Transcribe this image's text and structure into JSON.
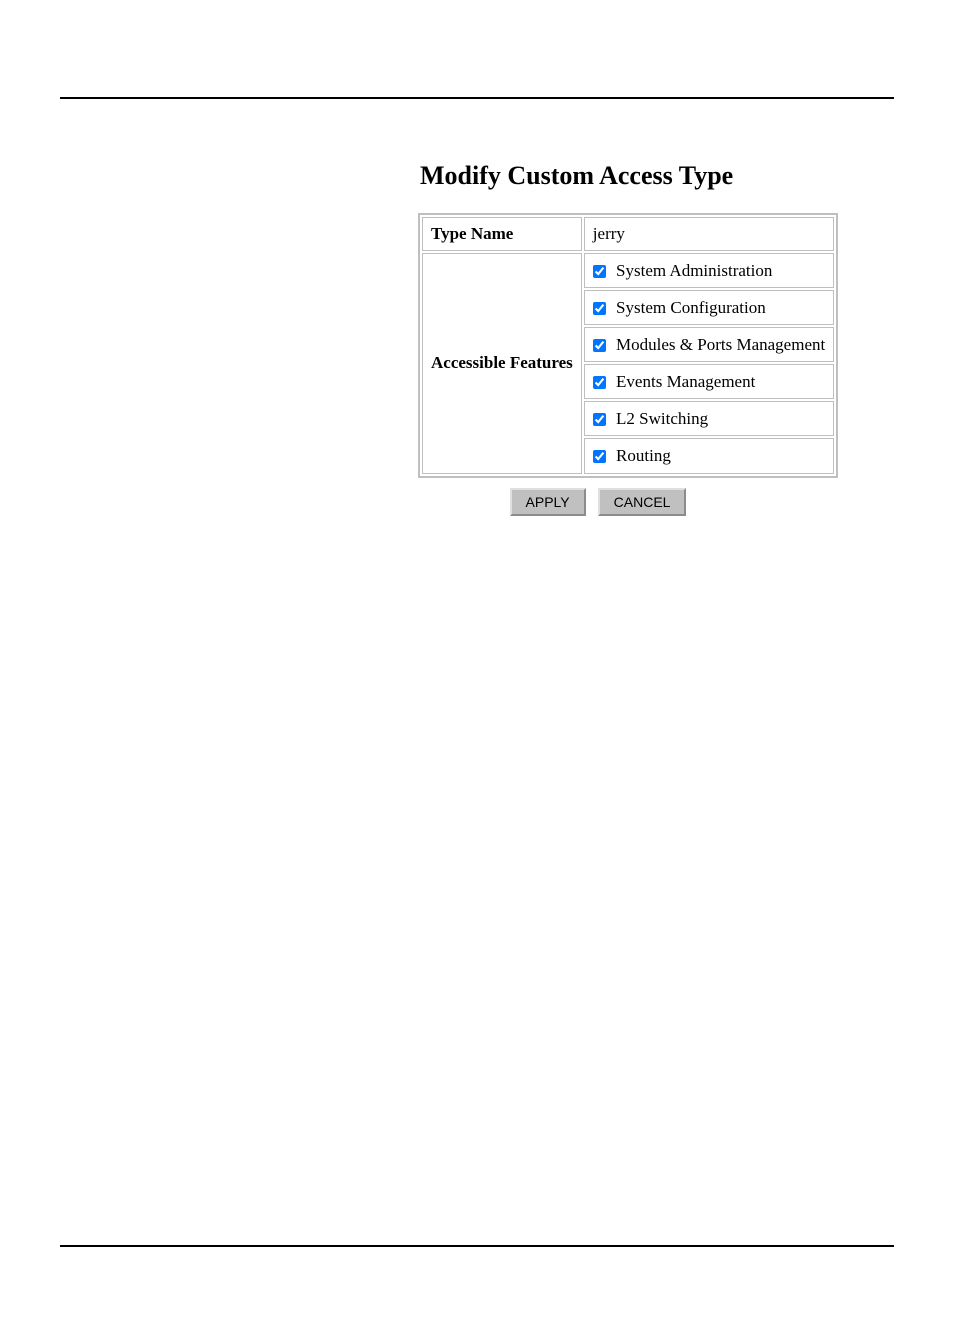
{
  "title": "Modify Custom Access Type",
  "labels": {
    "type_name": "Type Name",
    "accessible_features": "Accessible Features"
  },
  "type_name_value": "jerry",
  "features": [
    {
      "label": "System Administration",
      "checked": true
    },
    {
      "label": "System Configuration",
      "checked": true
    },
    {
      "label": "Modules & Ports Management",
      "checked": true
    },
    {
      "label": "Events Management",
      "checked": true
    },
    {
      "label": "L2 Switching",
      "checked": true
    },
    {
      "label": "Routing",
      "checked": true
    }
  ],
  "buttons": {
    "apply": "APPLY",
    "cancel": "CANCEL"
  }
}
